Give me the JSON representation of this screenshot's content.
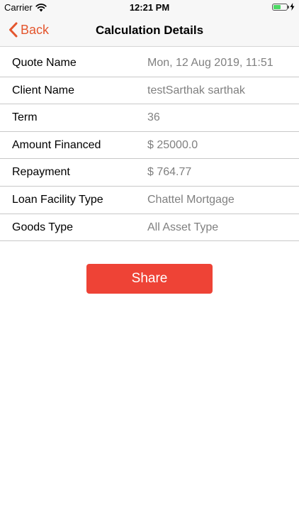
{
  "status_bar": {
    "carrier": "Carrier",
    "time": "12:21 PM",
    "battery_level": 0.55,
    "icons": [
      "wifi-icon",
      "battery-icon",
      "charging-icon"
    ]
  },
  "nav": {
    "back_label": "Back",
    "title": "Calculation Details",
    "accent_color": "#e4562e"
  },
  "details": [
    {
      "label": "Quote Name",
      "value": "Mon, 12 Aug 2019, 11:51"
    },
    {
      "label": "Client Name",
      "value": "testSarthak sarthak"
    },
    {
      "label": "Term",
      "value": "36"
    },
    {
      "label": "Amount Financed",
      "value": "$ 25000.0"
    },
    {
      "label": "Repayment",
      "value": "$ 764.77"
    },
    {
      "label": "Loan Facility Type",
      "value": "Chattel Mortgage"
    },
    {
      "label": "Goods Type",
      "value": "All Asset Type"
    }
  ],
  "share": {
    "label": "Share",
    "color": "#ee4336"
  }
}
